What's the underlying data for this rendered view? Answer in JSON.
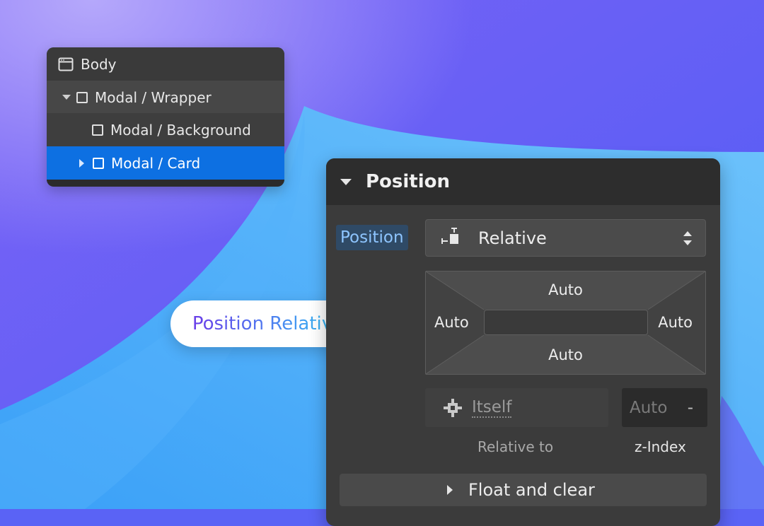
{
  "navigator": {
    "items": [
      {
        "label": "Body",
        "icon": "browser-window-icon"
      },
      {
        "label": "Modal / Wrapper",
        "icon": "box-icon"
      },
      {
        "label": "Modal / Background",
        "icon": "box-icon"
      },
      {
        "label": "Modal / Card",
        "icon": "box-icon",
        "selected": true
      }
    ]
  },
  "badge": {
    "text": "Position Relative"
  },
  "panel": {
    "title": "Position",
    "position_label": "Position",
    "position_value": "Relative",
    "offsets": {
      "top": "Auto",
      "right": "Auto",
      "bottom": "Auto",
      "left": "Auto"
    },
    "relative_to_value": "Itself",
    "relative_to_caption": "Relative to",
    "zindex_value": "Auto",
    "zindex_dash": "-",
    "zindex_caption": "z-Index",
    "float_label": "Float and clear"
  },
  "colors": {
    "accent_blue": "#0d70e2",
    "label_highlight": "#8ec5ff",
    "background_purple": "#5a63f5",
    "background_light_blue": "#4fa6f7"
  }
}
